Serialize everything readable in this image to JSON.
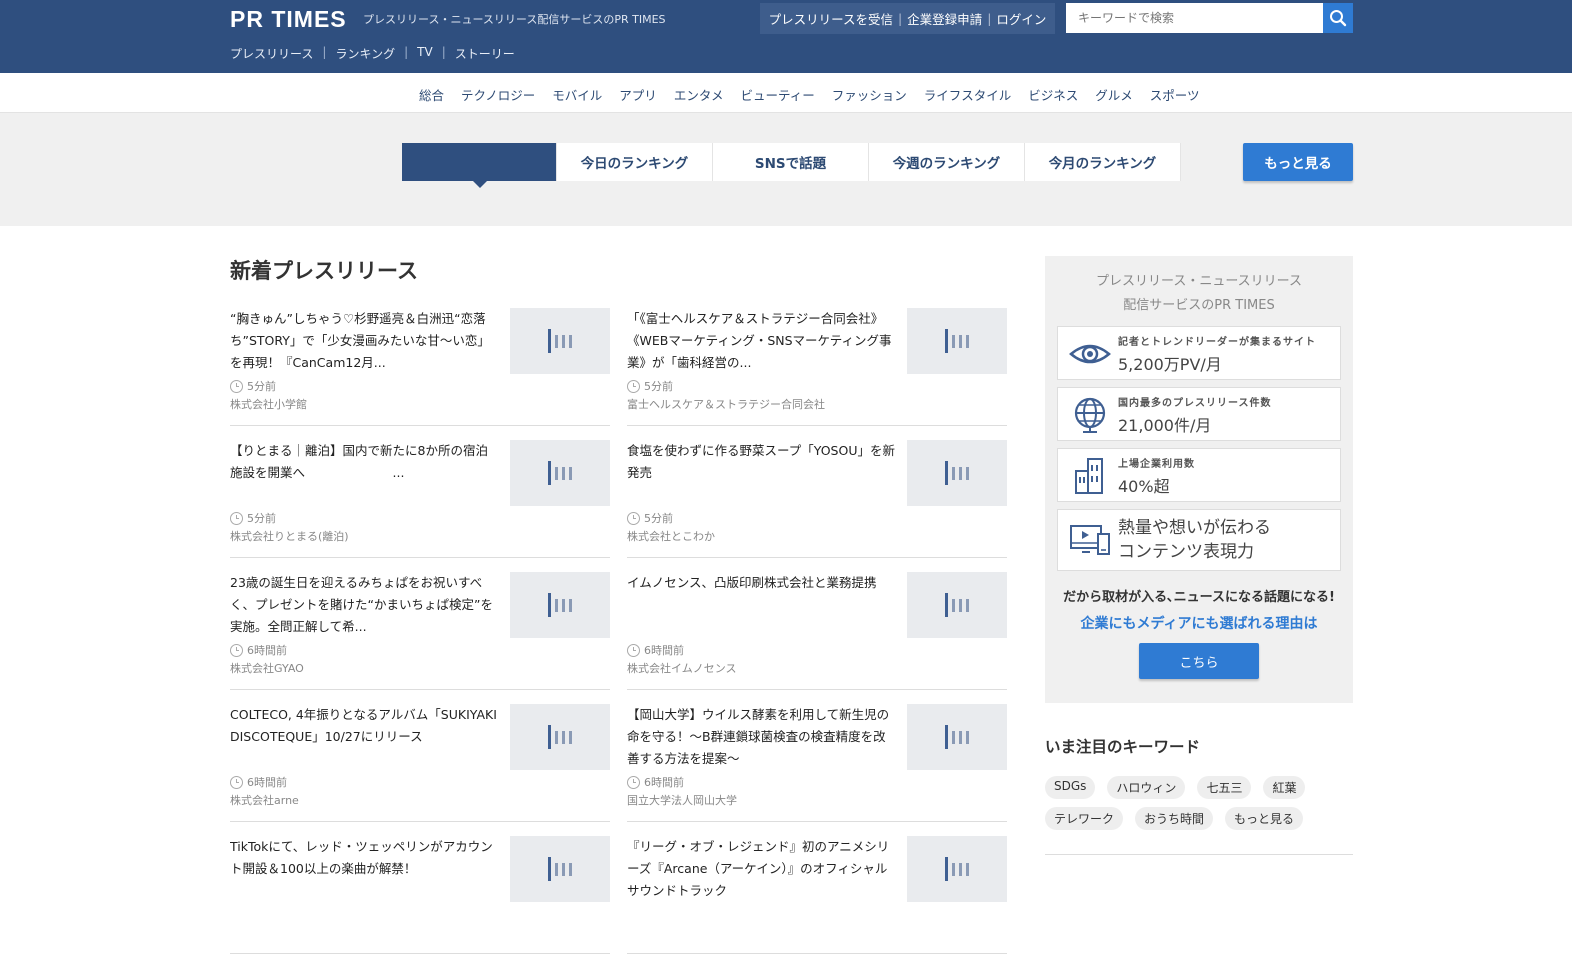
{
  "header": {
    "logo": "PR TIMES",
    "tagline": "プレスリリース・ニュースリリース配信サービスのPR TIMES",
    "nav": [
      "プレスリリース",
      "ランキング",
      "TV",
      "ストーリー"
    ],
    "account": [
      "プレスリリースを受信",
      "企業登録申請",
      "ログイン"
    ],
    "search_placeholder": "キーワードで検索"
  },
  "categories": [
    "総合",
    "テクノロジー",
    "モバイル",
    "アプリ",
    "エンタメ",
    "ビューティー",
    "ファッション",
    "ライフスタイル",
    "ビジネス",
    "グルメ",
    "スポーツ"
  ],
  "ranking_tabs": [
    "",
    "今日のランキング",
    "SNSで話題",
    "今週のランキング",
    "今月のランキング"
  ],
  "more_button": "もっと見る",
  "main": {
    "section_title": "新着プレスリリース",
    "articles": [
      {
        "title": "“胸きゅん”しちゃう♡杉野遥亮＆白洲迅“恋落ち”STORY」で「少女漫画みたいな甘〜い恋」を再現！『CanCam12月...",
        "time": "5分前",
        "company": "株式会社小学館"
      },
      {
        "title": "「《富士ヘルスケア＆ストラテジー合同会社》《WEBマーケティング・SNSマーケティング事業》が「歯科経営の...",
        "time": "5分前",
        "company": "富士ヘルスケア＆ストラテジー合同会社"
      },
      {
        "title": "【りとまる｜離泊】国内で新たに8か所の宿泊施設を開業へ　　　　　　　...",
        "time": "5分前",
        "company": "株式会社りとまる(離泊)"
      },
      {
        "title": "食塩を使わずに作る野菜スープ「YOSOU」を新発売",
        "time": "5分前",
        "company": "株式会社とこわか"
      },
      {
        "title": "23歳の誕生日を迎えるみちょぱをお祝いすべく、プレゼントを賭けた“かまいちょぱ検定”を実施。全問正解して希...",
        "time": "6時間前",
        "company": "株式会社GYAO"
      },
      {
        "title": "イムノセンス、凸版印刷株式会社と業務提携",
        "time": "6時間前",
        "company": "株式会社イムノセンス"
      },
      {
        "title": "COLTECO, 4年振りとなるアルバム「SUKIYAKI DISCOTEQUE」10/27にリリース",
        "time": "6時間前",
        "company": "株式会社arne"
      },
      {
        "title": "【岡山大学】ウイルス酵素を利用して新生児の命を守る！〜B群連鎖球菌検査の検査精度を改善する方法を提案〜",
        "time": "6時間前",
        "company": "国立大学法人岡山大学"
      },
      {
        "title": "TikTokにて、レッド・ツェッペリンがアカウント開設＆100以上の楽曲が解禁！",
        "time": "",
        "company": ""
      },
      {
        "title": "『リーグ・オブ・レジェンド』初のアニメシリーズ『Arcane（アーケイン）』のオフィシャルサウンドトラック",
        "time": "",
        "company": ""
      }
    ]
  },
  "sidebar": {
    "promo_head": [
      "プレスリリース・ニュースリリース",
      "配信サービスのPR TIMES"
    ],
    "features": [
      {
        "icon": "eye-icon",
        "small": "記者とトレンドリーダーが集まるサイト",
        "big": "5,200万PV/月"
      },
      {
        "icon": "globe-icon",
        "small": "国内最多のプレスリリース件数",
        "big": "21,000件/月"
      },
      {
        "icon": "building-icon",
        "small": "上場企業利用数",
        "big": "40%超"
      },
      {
        "icon": "devices-icon",
        "small": "",
        "big": "熱量や想いが伝わる\nコンテンツ表現力"
      }
    ],
    "why": "だから取材が入る､ニュースになる話題になる!",
    "why2": "企業にもメディアにも選ばれる理由は",
    "here_button": "こちら",
    "keywords_title": "いま注目のキーワード",
    "keywords": [
      "SDGs",
      "ハロウィン",
      "七五三",
      "紅葉",
      "テレワーク",
      "おうち時間",
      "もっと見る"
    ]
  },
  "colors": {
    "header_bg": "#2f4f7f",
    "accent": "#2f7bd3"
  }
}
